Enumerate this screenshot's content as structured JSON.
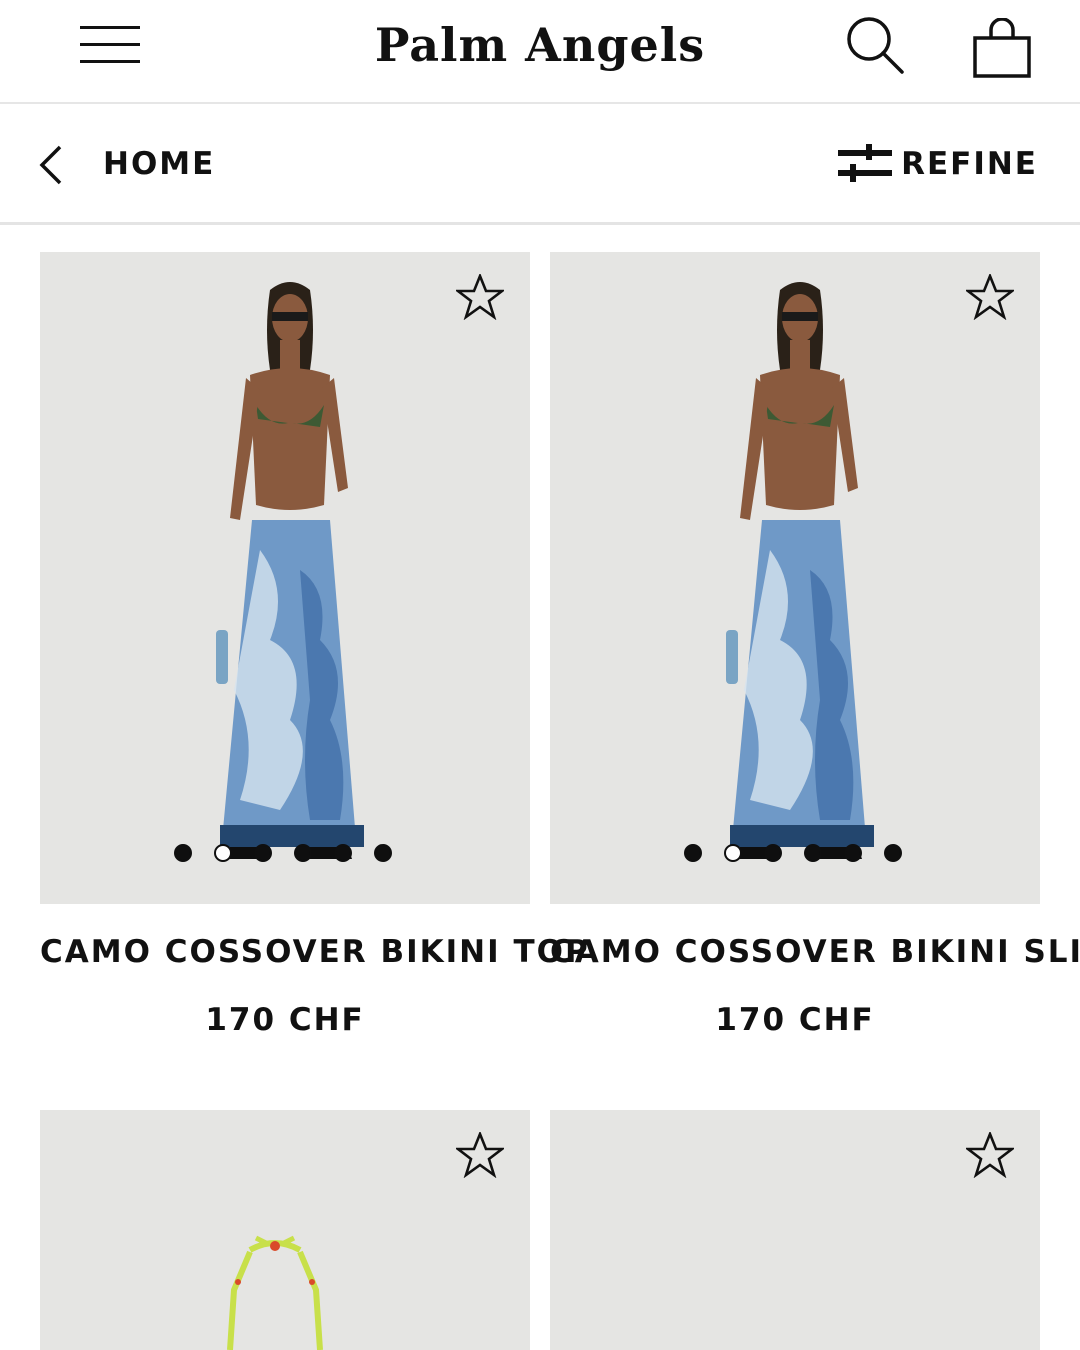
{
  "header": {
    "brand": "Palm Angels",
    "menu_icon": "hamburger-menu-icon",
    "search_icon": "search-icon",
    "bag_icon": "shopping-bag-icon"
  },
  "subnav": {
    "back_label": "HOME",
    "refine_label": "REFINE"
  },
  "products": [
    {
      "title": "CAMO COSSOVER BIKINI TOP",
      "price": "170 CHF",
      "active_image": 2,
      "image_count": 6
    },
    {
      "title": "CAMO COSSOVER BIKINI SLIP",
      "price": "170 CHF",
      "active_image": 2,
      "image_count": 6
    }
  ],
  "colors": {
    "text": "#111111",
    "image_bg": "#e5e5e3",
    "divider": "#e4e4e4"
  }
}
